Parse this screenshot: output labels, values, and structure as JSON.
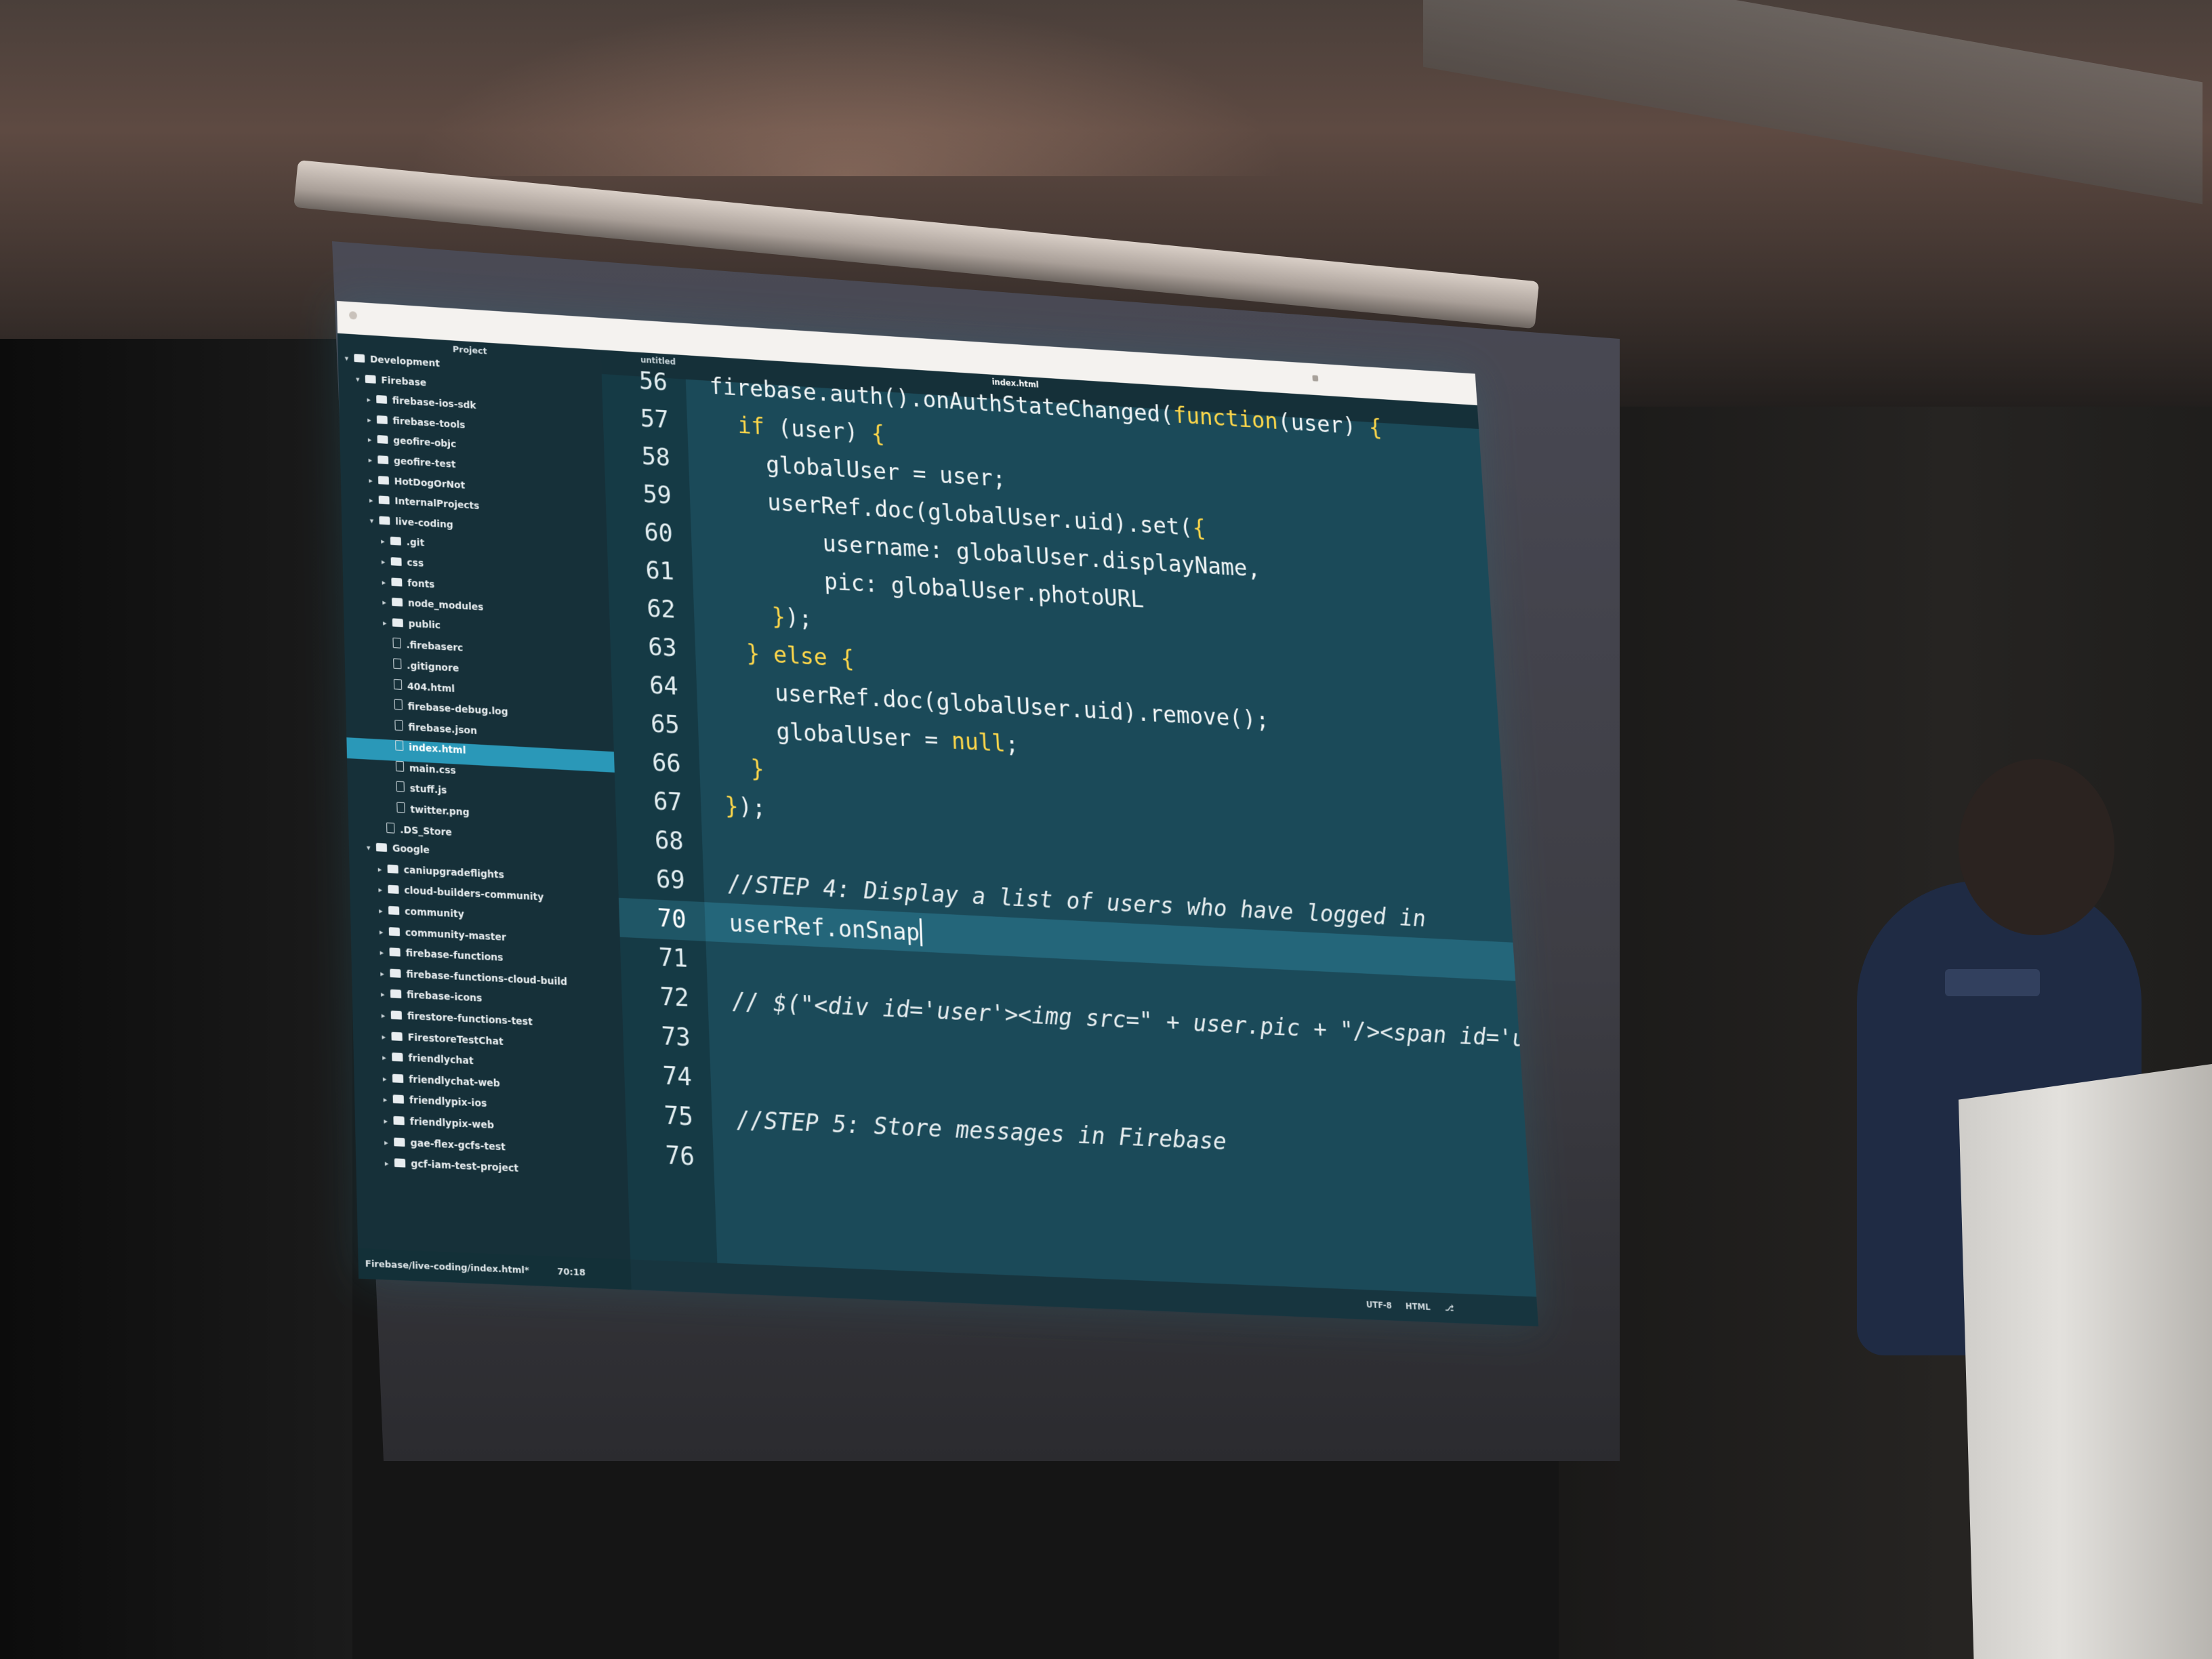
{
  "sidebar": {
    "panel_title": "Project",
    "tree": [
      {
        "label": "Development",
        "type": "folder",
        "depth": 0,
        "expanded": true
      },
      {
        "label": "Firebase",
        "type": "folder",
        "depth": 1,
        "expanded": true
      },
      {
        "label": "firebase-ios-sdk",
        "type": "folder",
        "depth": 2,
        "expanded": false
      },
      {
        "label": "firebase-tools",
        "type": "folder",
        "depth": 2,
        "expanded": false
      },
      {
        "label": "geofire-objc",
        "type": "folder",
        "depth": 2,
        "expanded": false
      },
      {
        "label": "geofire-test",
        "type": "folder",
        "depth": 2,
        "expanded": false
      },
      {
        "label": "HotDogOrNot",
        "type": "folder",
        "depth": 2,
        "expanded": false
      },
      {
        "label": "InternalProjects",
        "type": "folder",
        "depth": 2,
        "expanded": false
      },
      {
        "label": "live-coding",
        "type": "folder",
        "depth": 2,
        "expanded": true
      },
      {
        "label": ".git",
        "type": "folder",
        "depth": 3,
        "expanded": false
      },
      {
        "label": "css",
        "type": "folder",
        "depth": 3,
        "expanded": false
      },
      {
        "label": "fonts",
        "type": "folder",
        "depth": 3,
        "expanded": false
      },
      {
        "label": "node_modules",
        "type": "folder",
        "depth": 3,
        "expanded": false
      },
      {
        "label": "public",
        "type": "folder",
        "depth": 3,
        "expanded": false
      },
      {
        "label": ".firebaserc",
        "type": "file",
        "depth": 3
      },
      {
        "label": ".gitignore",
        "type": "file",
        "depth": 3
      },
      {
        "label": "404.html",
        "type": "file",
        "depth": 3
      },
      {
        "label": "firebase-debug.log",
        "type": "file",
        "depth": 3
      },
      {
        "label": "firebase.json",
        "type": "file",
        "depth": 3
      },
      {
        "label": "index.html",
        "type": "file",
        "depth": 3,
        "selected": true
      },
      {
        "label": "main.css",
        "type": "file",
        "depth": 3
      },
      {
        "label": "stuff.js",
        "type": "file",
        "depth": 3
      },
      {
        "label": "twitter.png",
        "type": "file",
        "depth": 3
      },
      {
        "label": ".DS_Store",
        "type": "file",
        "depth": 2
      },
      {
        "label": "Google",
        "type": "folder",
        "depth": 1,
        "expanded": true
      },
      {
        "label": "caniupgradeflights",
        "type": "folder",
        "depth": 2,
        "expanded": false
      },
      {
        "label": "cloud-builders-community",
        "type": "folder",
        "depth": 2,
        "expanded": false
      },
      {
        "label": "community",
        "type": "folder",
        "depth": 2,
        "expanded": false
      },
      {
        "label": "community-master",
        "type": "folder",
        "depth": 2,
        "expanded": false
      },
      {
        "label": "firebase-functions",
        "type": "folder",
        "depth": 2,
        "expanded": false
      },
      {
        "label": "firebase-functions-cloud-build",
        "type": "folder",
        "depth": 2,
        "expanded": false
      },
      {
        "label": "firebase-icons",
        "type": "folder",
        "depth": 2,
        "expanded": false
      },
      {
        "label": "firestore-functions-test",
        "type": "folder",
        "depth": 2,
        "expanded": false
      },
      {
        "label": "FirestoreTestChat",
        "type": "folder",
        "depth": 2,
        "expanded": false
      },
      {
        "label": "friendlychat",
        "type": "folder",
        "depth": 2,
        "expanded": false
      },
      {
        "label": "friendlychat-web",
        "type": "folder",
        "depth": 2,
        "expanded": false
      },
      {
        "label": "friendlypix-ios",
        "type": "folder",
        "depth": 2,
        "expanded": false
      },
      {
        "label": "friendlypix-web",
        "type": "folder",
        "depth": 2,
        "expanded": false
      },
      {
        "label": "gae-flex-gcfs-test",
        "type": "folder",
        "depth": 2,
        "expanded": false
      },
      {
        "label": "gcf-iam-test-project",
        "type": "folder",
        "depth": 2,
        "expanded": false
      }
    ]
  },
  "tabs": [
    {
      "label": "untitled",
      "active": false
    },
    {
      "label": "index.html",
      "active": true
    }
  ],
  "editor": {
    "current_line": 70,
    "lines": [
      {
        "n": "56",
        "text": "firebase.auth().onAuthStateChanged(function(user) {"
      },
      {
        "n": "57",
        "text": "  if (user) {"
      },
      {
        "n": "58",
        "text": "    globalUser = user;"
      },
      {
        "n": "59",
        "text": "    userRef.doc(globalUser.uid).set({"
      },
      {
        "n": "60",
        "text": "        username: globalUser.displayName,"
      },
      {
        "n": "61",
        "text": "        pic: globalUser.photoURL"
      },
      {
        "n": "62",
        "text": "    });"
      },
      {
        "n": "63",
        "text": "  } else {"
      },
      {
        "n": "64",
        "text": "    userRef.doc(globalUser.uid).remove();"
      },
      {
        "n": "65",
        "text": "    globalUser = null;"
      },
      {
        "n": "66",
        "text": "  }"
      },
      {
        "n": "67",
        "text": "});"
      },
      {
        "n": "68",
        "text": ""
      },
      {
        "n": "69",
        "text": "//STEP 4: Display a list of users who have logged in"
      },
      {
        "n": "70",
        "text": "userRef.onSnap"
      },
      {
        "n": "71",
        "text": ""
      },
      {
        "n": "72",
        "text": "// $(\"<div id='user'><img src=\" + user.pic + \"/><span id='username'>@\" +"
      },
      {
        "n": "73",
        "text": ""
      },
      {
        "n": "74",
        "text": ""
      },
      {
        "n": "75",
        "text": "//STEP 5: Store messages in Firebase"
      },
      {
        "n": "76",
        "text": ""
      }
    ]
  },
  "statusbar": {
    "path": "Firebase/live-coding/index.html*",
    "cursor": "70:18",
    "encoding": "UTF-8",
    "grammar": "HTML"
  },
  "colors": {
    "editor_bg": "#1b4a59",
    "gutter_bg": "#153a45",
    "sidebar_bg": "#163039",
    "selection": "#2a98b8",
    "keyword": "#ffd84a"
  }
}
